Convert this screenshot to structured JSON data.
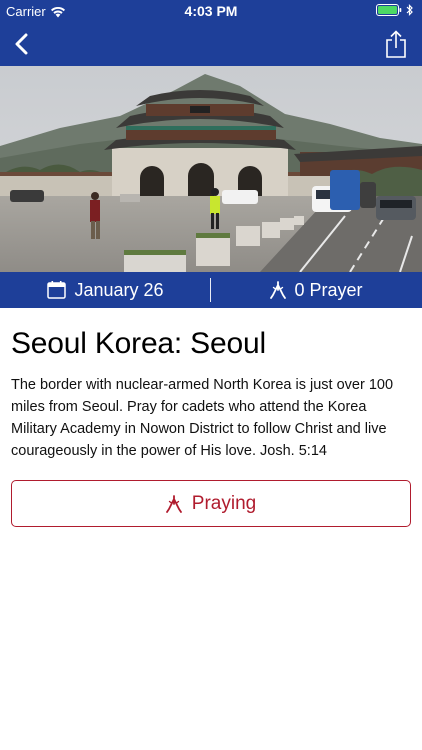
{
  "status_bar": {
    "carrier": "Carrier",
    "time": "4:03 PM",
    "wifi_icon": "wifi-icon",
    "battery_icon": "battery-icon",
    "battery_color": "#4cd964"
  },
  "nav": {
    "back_icon": "chevron-left-icon",
    "share_icon": "share-icon"
  },
  "hero": {
    "icon": "photo-gyeongbokgung-gate"
  },
  "info_bar": {
    "date_icon": "calendar-icon",
    "date": "January 26",
    "prayer_icon": "praying-hands-icon",
    "prayer_count": "0 Prayer"
  },
  "content": {
    "title": "Seoul Korea: Seoul",
    "body": "The border with nuclear-armed North Korea is just over 100 miles from Seoul. Pray for cadets who attend the Korea Military Academy in Nowon District to follow Christ and live courageously in the power of His love. Josh. 5:14"
  },
  "actions": {
    "praying_label": "Praying",
    "praying_icon": "praying-hands-icon"
  },
  "colors": {
    "brand_blue": "#1e3f99",
    "accent_red": "#b01c2e"
  }
}
